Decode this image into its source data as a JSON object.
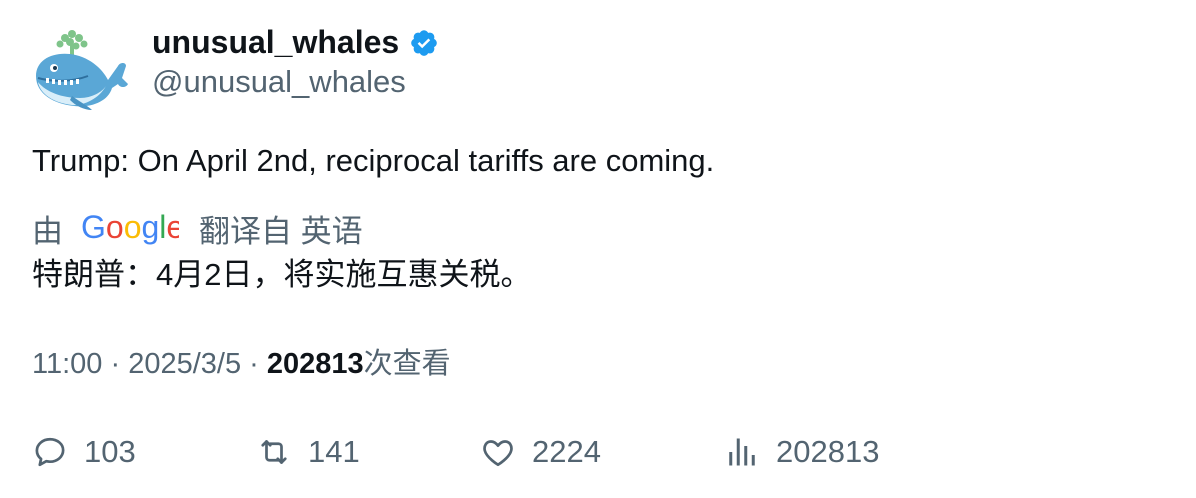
{
  "user": {
    "display_name": "unusual_whales",
    "handle": "@unusual_whales",
    "verified": true,
    "avatar_icon": "whale-icon"
  },
  "tweet": {
    "text": "Trump: On April 2nd, reciprocal tariffs are coming."
  },
  "translation": {
    "by_label": "由",
    "provider_logo": "google-logo",
    "translated_from_label": "翻译自 英语",
    "translated_text": "特朗普：4月2日，将实施互惠关税。"
  },
  "meta": {
    "time": "11:00",
    "separator": " · ",
    "date": "2025/3/5",
    "views_count": "202813",
    "views_suffix": "次查看"
  },
  "actions": {
    "replies": "103",
    "retweets": "141",
    "likes": "2224",
    "views": "202813"
  },
  "colors": {
    "primary_text": "#0f1419",
    "secondary_text": "#536471",
    "verified_blue": "#1d9bf0"
  }
}
